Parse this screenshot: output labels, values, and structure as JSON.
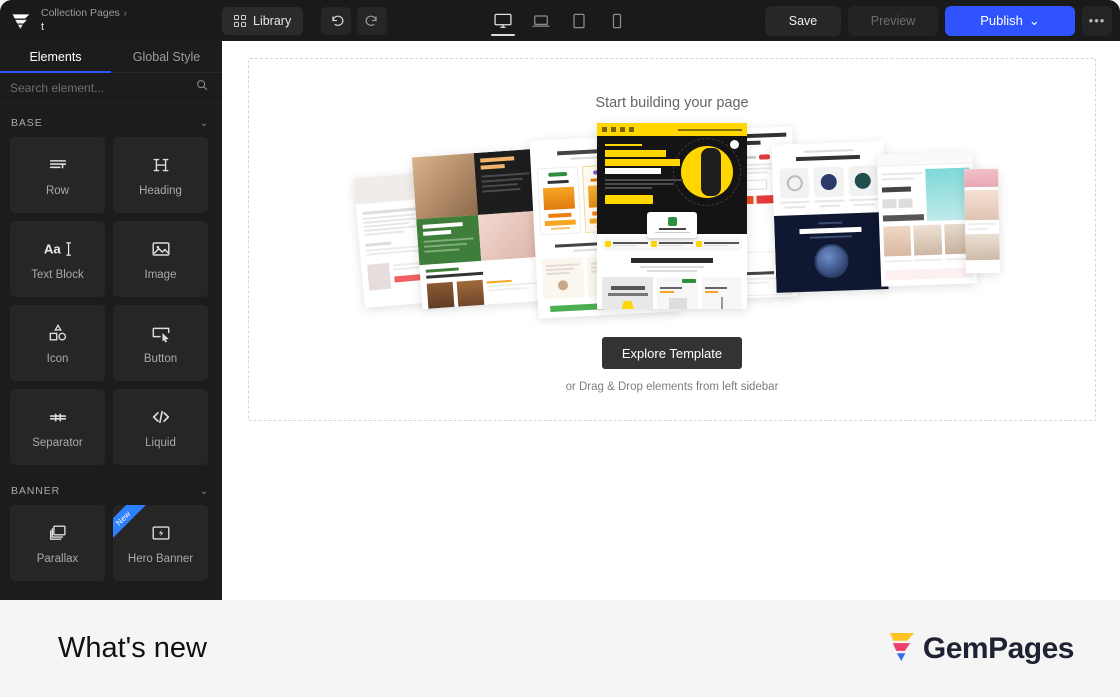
{
  "topbar": {
    "logo_icon": "gempages-logo-icon",
    "breadcrumb_parent": "Collection Pages",
    "breadcrumb_sep": "›",
    "page_title": "t",
    "library_label": "Library",
    "library_icon": "grid-icon",
    "undo_icon": "undo-icon",
    "redo_icon": "redo-icon",
    "devices": [
      {
        "name": "desktop",
        "icon": "desktop-icon",
        "active": true
      },
      {
        "name": "laptop",
        "icon": "laptop-icon",
        "active": false
      },
      {
        "name": "tablet",
        "icon": "tablet-icon",
        "active": false
      },
      {
        "name": "mobile",
        "icon": "mobile-icon",
        "active": false
      }
    ],
    "save_label": "Save",
    "preview_label": "Preview",
    "publish_label": "Publish",
    "publish_caret": "⌄",
    "more_label": "•••",
    "publish_color": "#2f54ff"
  },
  "sidebar": {
    "tabs": [
      {
        "label": "Elements",
        "active": true
      },
      {
        "label": "Global Style",
        "active": false
      }
    ],
    "search": {
      "placeholder": "Search element...",
      "value": "",
      "icon": "search-icon"
    },
    "groups": [
      {
        "title": "BASE",
        "chevron": "⌄",
        "items": [
          {
            "label": "Row",
            "icon": "row-icon",
            "badge": ""
          },
          {
            "label": "Heading",
            "icon": "heading-icon",
            "badge": ""
          },
          {
            "label": "Text Block",
            "icon": "text-block-icon",
            "badge": ""
          },
          {
            "label": "Image",
            "icon": "image-icon",
            "badge": ""
          },
          {
            "label": "Icon",
            "icon": "shapes-icon",
            "badge": ""
          },
          {
            "label": "Button",
            "icon": "button-icon",
            "badge": ""
          },
          {
            "label": "Separator",
            "icon": "separator-icon",
            "badge": ""
          },
          {
            "label": "Liquid",
            "icon": "code-icon",
            "badge": ""
          }
        ]
      },
      {
        "title": "BANNER",
        "chevron": "⌄",
        "items": [
          {
            "label": "Parallax",
            "icon": "layers-icon",
            "badge": ""
          },
          {
            "label": "Hero Banner",
            "icon": "lightning-icon",
            "badge": "New"
          }
        ]
      }
    ]
  },
  "canvas": {
    "dropzone_title": "Start building your page",
    "explore_label": "Explore Template",
    "hint": "or Drag & Drop elements from left sidebar",
    "templates": [
      {
        "name": "template-thumb-1"
      },
      {
        "name": "template-thumb-2"
      },
      {
        "name": "template-thumb-3"
      },
      {
        "name": "template-thumb-4"
      },
      {
        "name": "template-thumb-5"
      },
      {
        "name": "template-thumb-6"
      },
      {
        "name": "template-thumb-7"
      },
      {
        "name": "template-thumb-8"
      }
    ]
  },
  "banner": {
    "title": "What's new",
    "brand": "GemPages",
    "brand_icon": "gempages-logo-icon"
  }
}
